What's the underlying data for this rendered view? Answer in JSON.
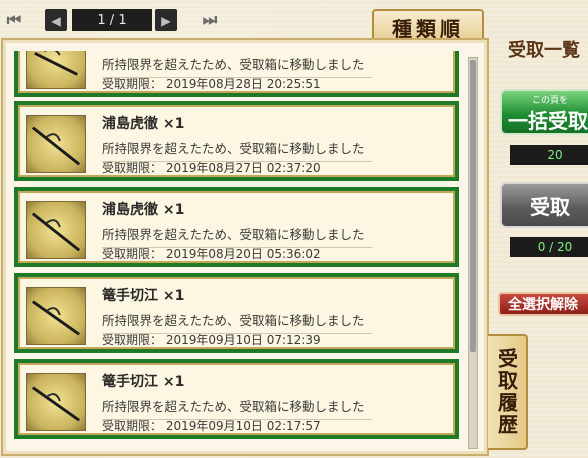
{
  "pager": {
    "first_icon": "first-page-icon",
    "prev_icon": "prev-page-icon",
    "next_icon": "next-page-icon",
    "last_icon": "last-page-icon",
    "page_text": "1 / 1",
    "first_glyph": "⏮",
    "prev_glyph": "◀",
    "next_glyph": "▶",
    "last_glyph": "⏭"
  },
  "sort_tab": {
    "label": "種類順"
  },
  "items": [
    {
      "title": "",
      "message": "所持限界を超えたため、受取箱に移動しました",
      "limit": "受取期限： 2019年08月28日 20:25:51"
    },
    {
      "title": "浦島虎徹 ×1",
      "message": "所持限界を超えたため、受取箱に移動しました",
      "limit": "受取期限： 2019年08月27日 02:37:20"
    },
    {
      "title": "浦島虎徹 ×1",
      "message": "所持限界を超えたため、受取箱に移動しました",
      "limit": "受取期限： 2019年08月20日 05:36:02"
    },
    {
      "title": "篭手切江 ×1",
      "message": "所持限界を超えたため、受取箱に移動しました",
      "limit": "受取期限： 2019年09月10日 07:12:39"
    },
    {
      "title": "篭手切江 ×1",
      "message": "所持限界を超えたため、受取箱に移動しました",
      "limit": "受取期限： 2019年09月10日 02:17:57"
    }
  ],
  "side": {
    "title": "受取一覧",
    "bulk_small": "この頁を",
    "bulk_label": "一括受取",
    "bulk_count": "20",
    "receive_label": "受取",
    "receive_count": "0 / 20",
    "clear_label": "全選択解除",
    "history_label": "受取履歴"
  },
  "colors": {
    "row_border": "#1f7a28",
    "bulk_green": "#1f8d33",
    "clear_red": "#8f1e17"
  }
}
